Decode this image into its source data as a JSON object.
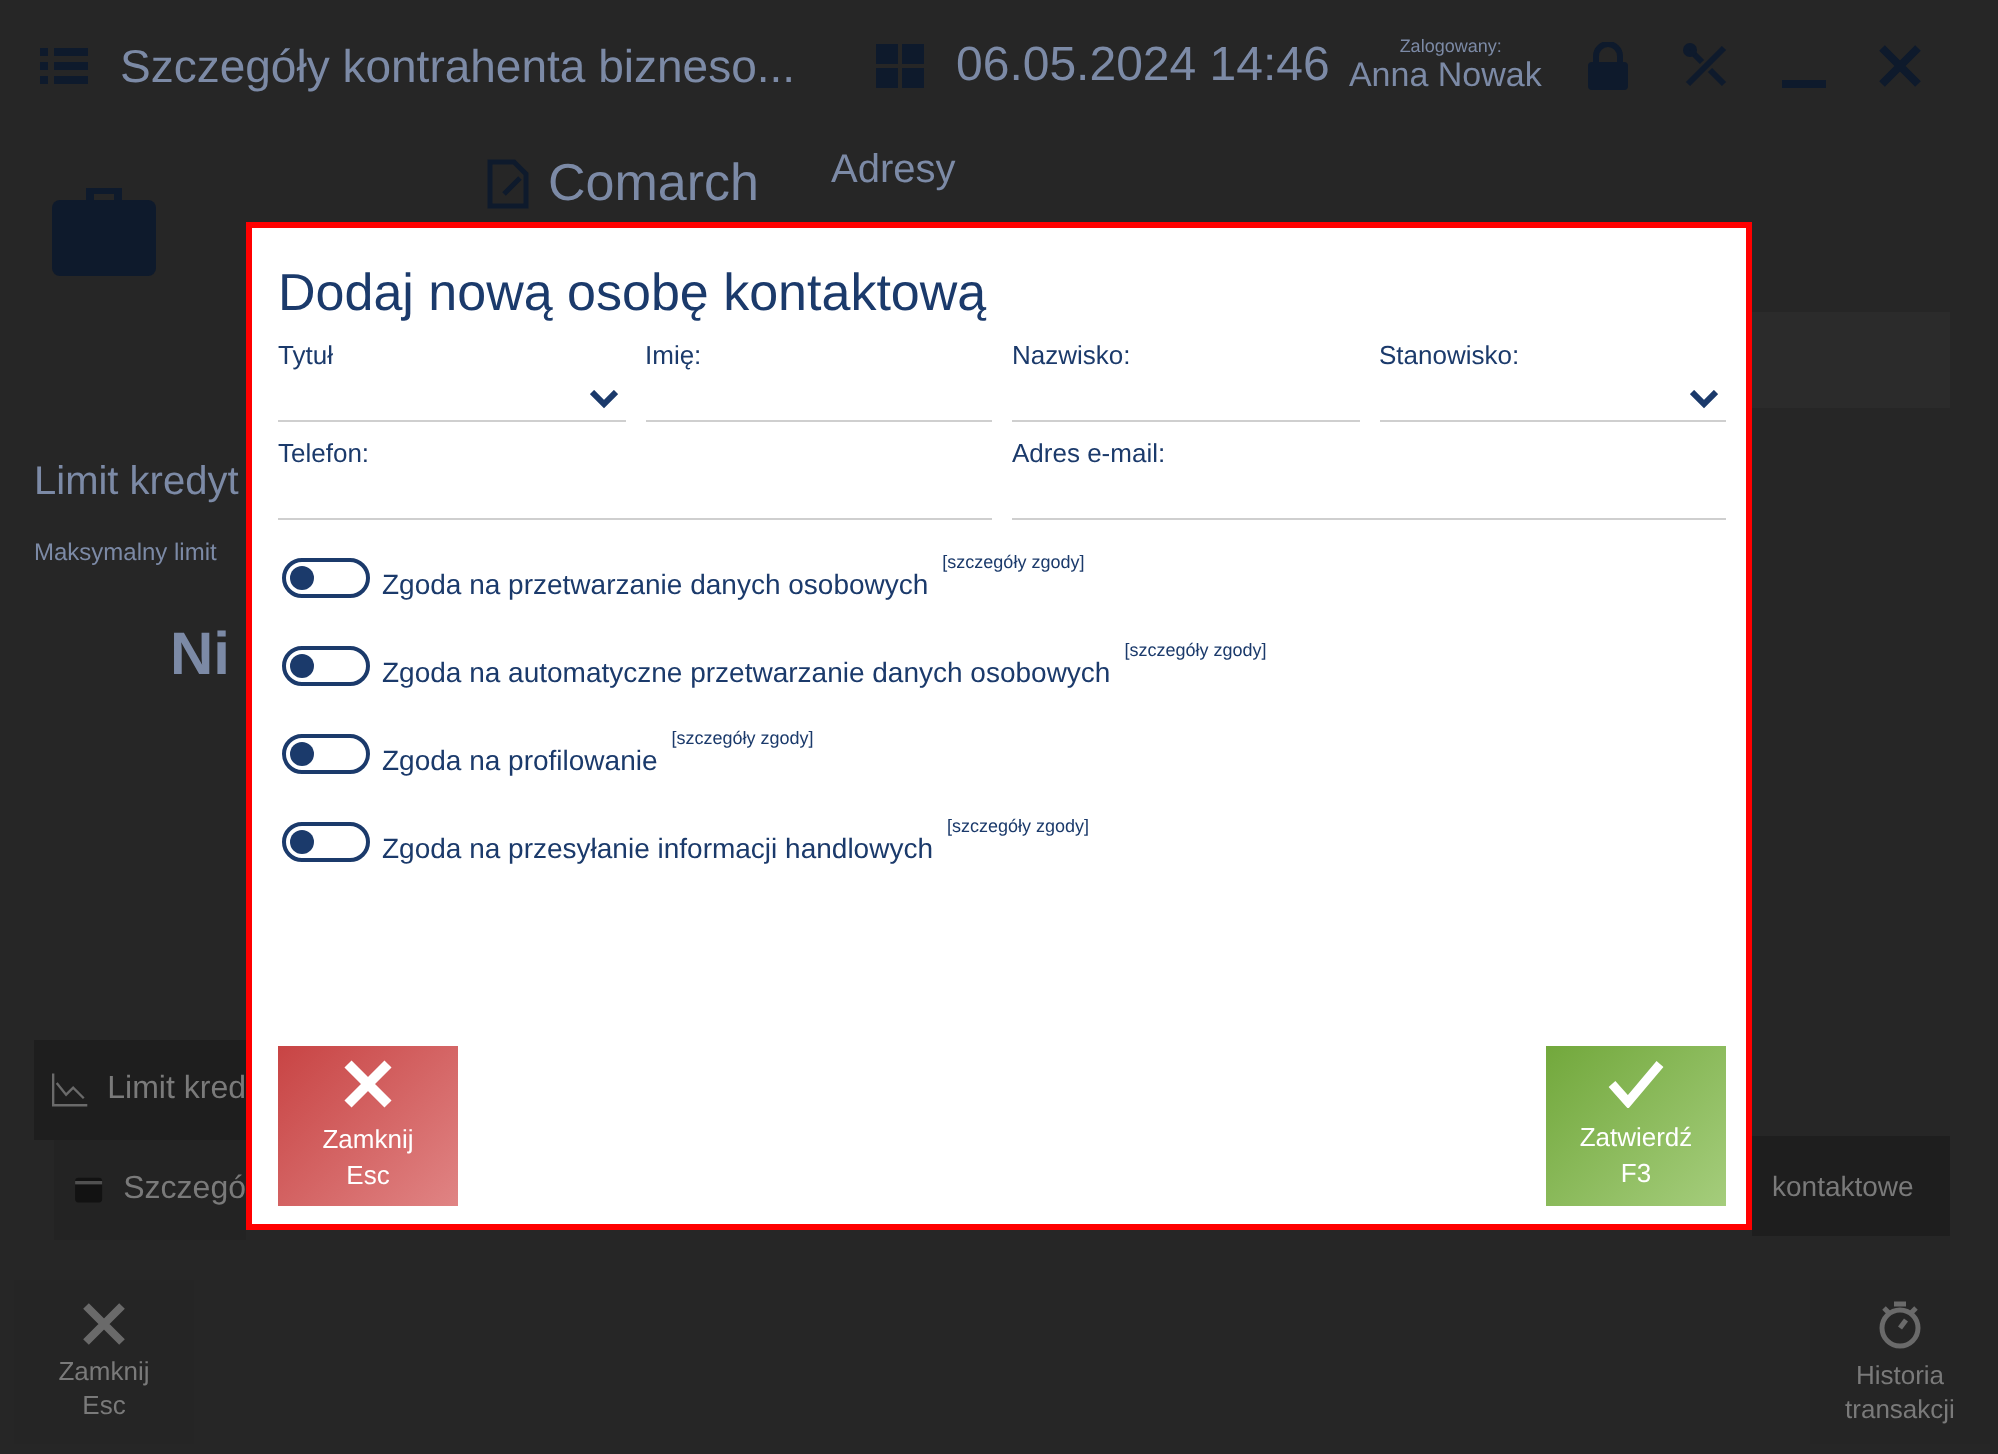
{
  "header": {
    "title": "Szczegóły kontrahenta bizneso...",
    "datetime": "06.05.2024 14:46",
    "user_caption": "Zalogowany:",
    "user_name": "Anna Nowak"
  },
  "tabs": [
    {
      "label": "Comarch",
      "selected": true
    },
    {
      "label": "Adresy",
      "selected": false
    }
  ],
  "credit": {
    "title": "Limit kredyt",
    "subtitle": "Maksymalny limit",
    "value": "Ni"
  },
  "sections": [
    {
      "label": "Limit kred",
      "selected": true
    },
    {
      "label": "Szczegó",
      "selected": false
    }
  ],
  "side_section": {
    "label": "kontaktowe"
  },
  "footer_buttons": [
    {
      "kind": "close",
      "label": "Zamknij",
      "shortcut": "Esc"
    },
    {
      "kind": "history",
      "label": "Historia",
      "shortcut": "transakcji"
    }
  ],
  "dialog": {
    "title": "Dodaj nową osobę kontaktową",
    "field_rows": [
      [
        {
          "kind": "select",
          "label": "Tytuł"
        },
        {
          "kind": "text",
          "label": "Imię:"
        },
        {
          "kind": "text",
          "label": "Nazwisko:"
        },
        {
          "kind": "select",
          "label": "Stanowisko:"
        }
      ],
      [
        {
          "kind": "text",
          "label": "Telefon:"
        },
        {
          "kind": "text",
          "label": "Adres e-mail:"
        }
      ]
    ],
    "consents": [
      {
        "label": "Zgoda na przetwarzanie danych osobowych",
        "link": "[szczegóły zgody]",
        "on": false
      },
      {
        "label": "Zgoda na automatyczne przetwarzanie danych osobowych",
        "link": "[szczegóły zgody]",
        "on": false
      },
      {
        "label": "Zgoda na profilowanie",
        "link": "[szczegóły zgody]",
        "on": false
      },
      {
        "label": "Zgoda na przesyłanie informacji handlowych",
        "link": "[szczegóły zgody]",
        "on": false
      }
    ],
    "buttons": [
      {
        "kind": "close",
        "label": "Zamknij",
        "shortcut": "Esc"
      },
      {
        "kind": "confirm",
        "label": "Zatwierdź",
        "shortcut": "F3"
      }
    ]
  }
}
